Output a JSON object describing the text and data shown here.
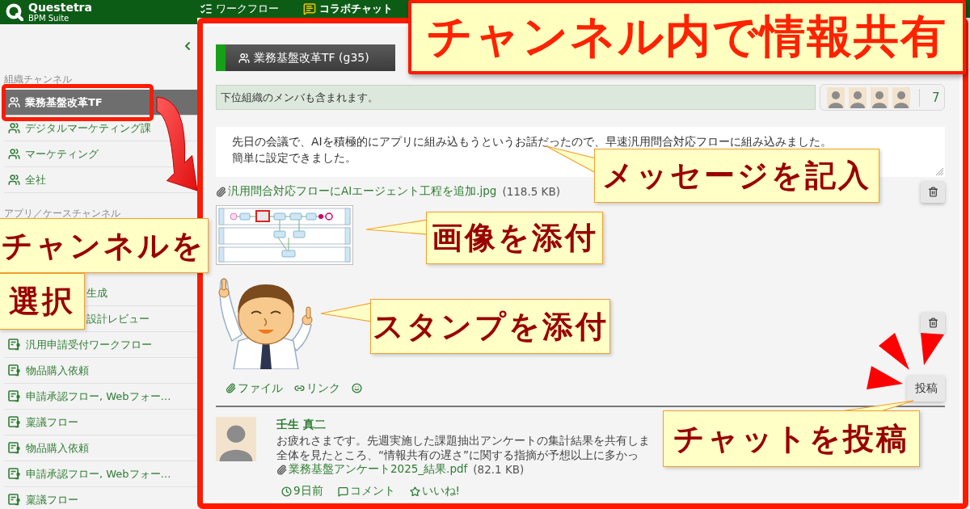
{
  "header": {
    "brand": {
      "name": "Questetra",
      "subtitle": "BPM Suite"
    },
    "tabs": [
      {
        "label": "ワークフロー",
        "selected": false
      },
      {
        "label": "コラボチャット",
        "selected": true
      }
    ]
  },
  "sidebar": {
    "sections": [
      {
        "title": "組織チャンネル",
        "items": [
          {
            "label": "業務基盤改革TF",
            "kind": "org",
            "selected": true
          },
          {
            "label": "デジタルマーケティング課",
            "kind": "org",
            "selected": false
          },
          {
            "label": "マーケティング",
            "kind": "org",
            "selected": false
          },
          {
            "label": "全社",
            "kind": "org",
            "selected": false
          }
        ]
      },
      {
        "title": "アプリ／ケースチャンネル",
        "items": [
          {
            "label": "生成",
            "kind": "cut",
            "selected": false
          },
          {
            "label": "設計レビュー",
            "kind": "cut",
            "selected": false
          },
          {
            "label": "汎用申請受付ワークフロー",
            "kind": "app",
            "selected": false
          },
          {
            "label": "物品購入依頼",
            "kind": "app",
            "selected": false
          },
          {
            "label": "申請承認フロー, Webフォー…",
            "kind": "app",
            "selected": false
          },
          {
            "label": "稟議フロー",
            "kind": "app",
            "selected": false
          },
          {
            "label": "物品購入依頼",
            "kind": "app",
            "selected": false
          },
          {
            "label": "申請承認フロー, Webフォー…",
            "kind": "app",
            "selected": false
          },
          {
            "label": "稟議フロー",
            "kind": "app",
            "selected": false
          }
        ]
      }
    ]
  },
  "channel": {
    "title": "業務基盤改革TF (g35)",
    "notice": "下位組織のメンバも含まれます。",
    "member_count": "7"
  },
  "composer": {
    "value": "先日の会議で、AIを積極的にアプリに組み込もうというお話だったので、早速汎用問合対応フローに組み込みました。簡単に設定できました。",
    "attachment": {
      "name": "汎用問合対応フローにAIエージェント工程を追加.jpg",
      "size": "(118.5 KB)"
    },
    "tools": [
      {
        "kind": "file",
        "label": "ファイル"
      },
      {
        "kind": "link",
        "label": "リンク"
      },
      {
        "kind": "emoji"
      }
    ],
    "post_button": "投稿"
  },
  "posts": [
    {
      "author": "壬生 真二",
      "text": "お疲れさまです。先週実施した課題抽出アンケートの集計結果を共有しま全体を見たところ、“情報共有の遅さ”に関する指摘が予想以上に多かっ",
      "attachment": {
        "name": "業務基盤アンケート2025_結果.pdf",
        "size": "(82.1 KB)"
      },
      "actions": [
        {
          "kind": "time",
          "label": "9日前"
        },
        {
          "kind": "comment",
          "label": "コメント"
        },
        {
          "kind": "like",
          "label": "いいね!"
        }
      ]
    }
  ],
  "annotations": [
    {
      "kind": "title",
      "text": "チャンネル内で情報共有"
    },
    {
      "kind": "note",
      "text": "チャンネルを"
    },
    {
      "kind": "note",
      "text": "選択"
    },
    {
      "kind": "note",
      "text": "メッセージを記入"
    },
    {
      "kind": "note",
      "text": "画像を添付"
    },
    {
      "kind": "note",
      "text": "スタンプを添付"
    },
    {
      "kind": "note",
      "text": "チャットを投稿"
    }
  ]
}
